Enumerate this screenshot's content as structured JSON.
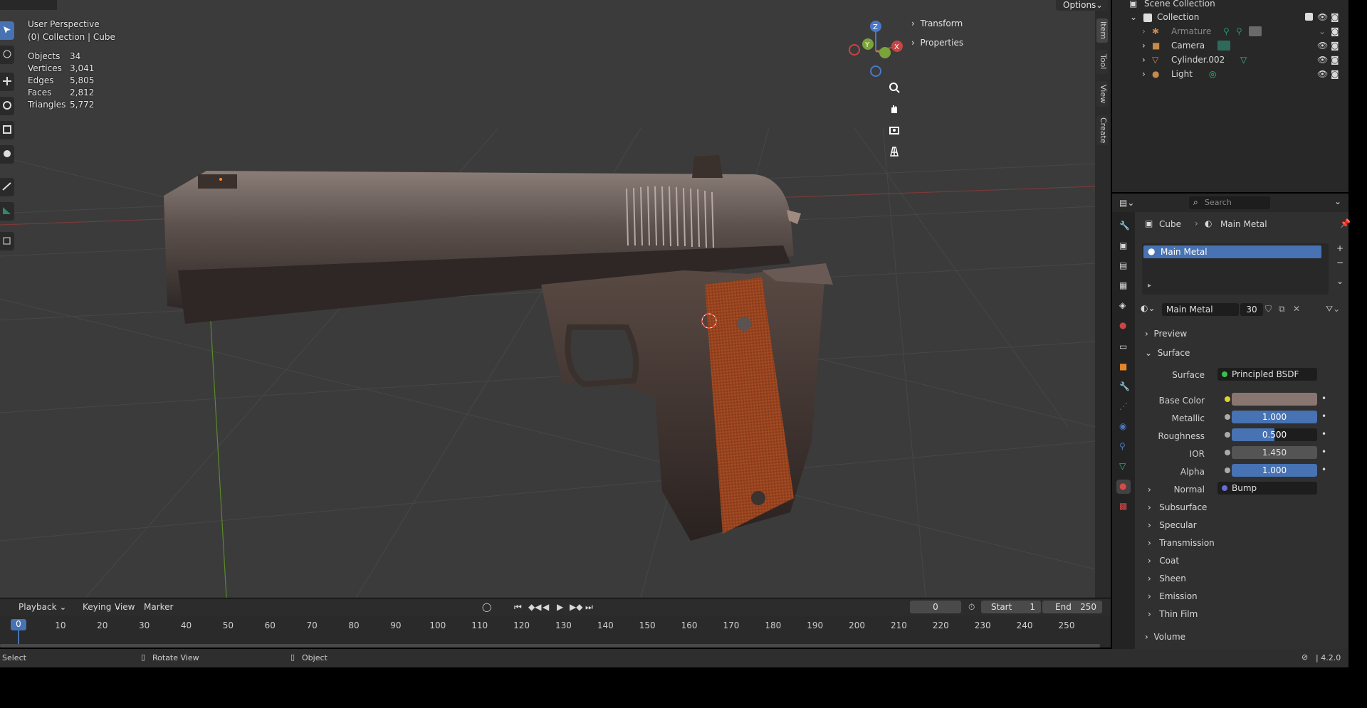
{
  "viewport": {
    "view_name": "User Perspective",
    "collection_path": "(0) Collection | Cube",
    "stats": [
      {
        "label": "Objects",
        "value": "34"
      },
      {
        "label": "Vertices",
        "value": "3,041"
      },
      {
        "label": "Edges",
        "value": "5,805"
      },
      {
        "label": "Faces",
        "value": "2,812"
      },
      {
        "label": "Triangles",
        "value": "5,772"
      }
    ],
    "options_label": "Options",
    "gizmo": {
      "x": "X",
      "y": "Y",
      "z": "Z"
    },
    "npanel_items": [
      "Transform",
      "Properties"
    ],
    "ntabs": [
      "Item",
      "Tool",
      "View",
      "Create"
    ],
    "colors": {
      "background": "#3b3b3b",
      "grip": "#8a3d1c",
      "metal": "#6a5a52"
    }
  },
  "outliner": {
    "title": "Scene Collection",
    "collection": "Collection",
    "items": [
      {
        "name": "Armature",
        "icon": "armature-icon"
      },
      {
        "name": "Camera",
        "icon": "camera-icon"
      },
      {
        "name": "Cylinder.002",
        "icon": "mesh-icon"
      },
      {
        "name": "Light",
        "icon": "light-icon"
      }
    ]
  },
  "properties": {
    "search_placeholder": "Search",
    "breadcrumb": {
      "object": "Cube",
      "material": "Main Metal"
    },
    "slot": "Main Metal",
    "material_name": "Main Metal",
    "user_count": "30",
    "sections": {
      "preview": "Preview",
      "surface": "Surface",
      "subsurface": "Subsurface",
      "specular": "Specular",
      "transmission": "Transmission",
      "coat": "Coat",
      "sheen": "Sheen",
      "emission": "Emission",
      "thin_film": "Thin Film",
      "volume": "Volume"
    },
    "fields": {
      "surface_label": "Surface",
      "surface_value": "Principled BSDF",
      "base_color_label": "Base Color",
      "base_color_value": "#8a7670",
      "metallic_label": "Metallic",
      "metallic_value": "1.000",
      "metallic_level": 1.0,
      "roughness_label": "Roughness",
      "roughness_value": "0.500",
      "roughness_level": 0.5,
      "ior_label": "IOR",
      "ior_value": "1.450",
      "alpha_label": "Alpha",
      "alpha_value": "1.000",
      "alpha_level": 1.0,
      "normal_label": "Normal",
      "normal_value": "Bump"
    }
  },
  "timeline": {
    "menus": [
      "Playback",
      "Keying",
      "View",
      "Marker"
    ],
    "current_frame": "0",
    "start_label": "Start",
    "start_value": "1",
    "end_label": "End",
    "end_value": "250",
    "playhead": "0",
    "ticks": [
      "10",
      "20",
      "30",
      "40",
      "50",
      "60",
      "70",
      "80",
      "90",
      "100",
      "110",
      "120",
      "130",
      "140",
      "150",
      "160",
      "170",
      "180",
      "190",
      "200",
      "210",
      "220",
      "230",
      "240",
      "250"
    ]
  },
  "statusbar": {
    "select": "Select",
    "rotate": "Rotate View",
    "object": "Object",
    "version": "4.2.0"
  }
}
